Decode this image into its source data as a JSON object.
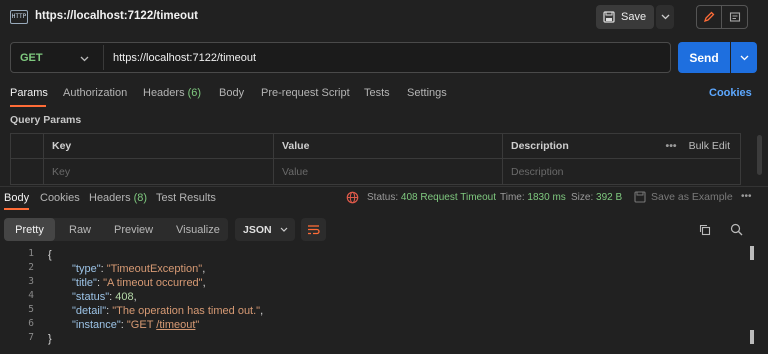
{
  "header": {
    "icon_text": "HTTP",
    "title": "https://localhost:7122/timeout",
    "save_label": "Save"
  },
  "request": {
    "method": "GET",
    "url": "https://localhost:7122/timeout",
    "send_label": "Send",
    "tabs": [
      {
        "label": "Params",
        "active": true
      },
      {
        "label": "Authorization"
      },
      {
        "label": "Headers",
        "badge": "(6)"
      },
      {
        "label": "Body"
      },
      {
        "label": "Pre-request Script"
      },
      {
        "label": "Tests"
      },
      {
        "label": "Settings"
      }
    ],
    "cookies_label": "Cookies",
    "query_params_label": "Query Params",
    "params_table": {
      "headers": [
        "Key",
        "Value",
        "Description"
      ],
      "placeholders": [
        "Key",
        "Value",
        "Description"
      ],
      "more_label": "•••",
      "bulk_edit_label": "Bulk Edit"
    }
  },
  "response": {
    "tabs": [
      {
        "label": "Body",
        "active": true
      },
      {
        "label": "Cookies"
      },
      {
        "label": "Headers",
        "badge": "(8)"
      },
      {
        "label": "Test Results"
      }
    ],
    "status_label": "Status:",
    "status_value": "408 Request Timeout",
    "time_label": "Time:",
    "time_value": "1830 ms",
    "size_label": "Size:",
    "size_value": "392 B",
    "save_example_label": "Save as Example",
    "more_label": "•••",
    "view_modes": [
      "Pretty",
      "Raw",
      "Preview",
      "Visualize"
    ],
    "active_view": "Pretty",
    "format": "JSON",
    "body_lines": [
      {
        "n": "1",
        "text": "{"
      },
      {
        "n": "2",
        "key": "\"type\"",
        "value": "\"TimeoutException\"",
        "tail": ","
      },
      {
        "n": "3",
        "key": "\"title\"",
        "value": "\"A timeout occurred\"",
        "tail": ","
      },
      {
        "n": "4",
        "key": "\"status\"",
        "value": "408",
        "tail": ","
      },
      {
        "n": "5",
        "key": "\"detail\"",
        "value": "\"The operation has timed out.\"",
        "tail": ","
      },
      {
        "n": "6",
        "key": "\"instance\"",
        "value_pre": "\"GET ",
        "value_link": "/timeout",
        "value_post": "\""
      },
      {
        "n": "7",
        "text": "}"
      }
    ]
  },
  "colors": {
    "accent": "#ff6c37",
    "send": "#1e6fdf",
    "link": "#5da8ff",
    "status_ok": "#7fc97f",
    "json_key": "#9cc3e6",
    "json_string": "#d79a74"
  }
}
